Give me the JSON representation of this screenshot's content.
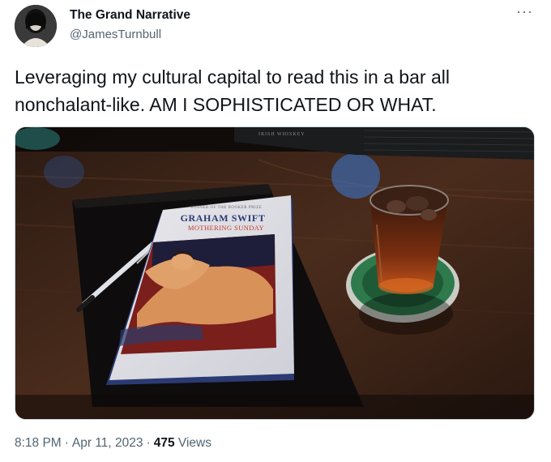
{
  "author": {
    "display_name": "The Grand Narrative",
    "handle": "@JamesTurnbull"
  },
  "menu": {
    "more_icon": "more-horizontal-icon",
    "more_glyph": "···"
  },
  "tweet": {
    "text": "Leveraging my cultural capital to read this in a bar all nonchalant-like. AM I SOPHISTICATED OR WHAT."
  },
  "photo": {
    "book_prize": "WINNER OF THE BOOKER PRIZE",
    "book_author": "GRAHAM SWIFT",
    "book_title": "MOTHERING SUNDAY",
    "mat_text": "IRISH WHISKEY"
  },
  "meta": {
    "time": "8:18 PM",
    "separator": "·",
    "date": "Apr 11, 2023",
    "views_count": "475",
    "views_label": "Views"
  }
}
